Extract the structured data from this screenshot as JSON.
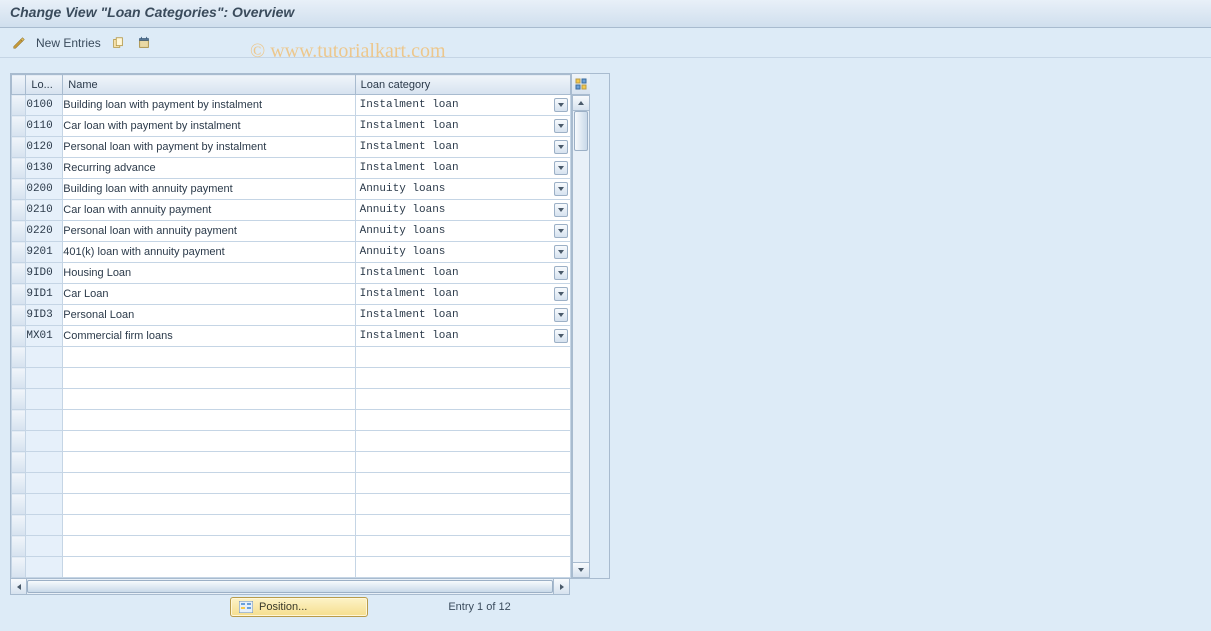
{
  "title": "Change View \"Loan Categories\": Overview",
  "toolbar": {
    "new_entries_label": "New Entries"
  },
  "watermark": "© www.tutorialkart.com",
  "columns": {
    "code": "Lo...",
    "name": "Name",
    "category": "Loan category"
  },
  "rows": [
    {
      "code": "0100",
      "name": "Building loan with payment by instalment",
      "category": "Instalment loan"
    },
    {
      "code": "0110",
      "name": "Car loan with payment by instalment",
      "category": "Instalment loan"
    },
    {
      "code": "0120",
      "name": "Personal loan with payment by instalment",
      "category": "Instalment loan"
    },
    {
      "code": "0130",
      "name": "Recurring advance",
      "category": "Instalment loan"
    },
    {
      "code": "0200",
      "name": "Building loan with annuity payment",
      "category": "Annuity loans"
    },
    {
      "code": "0210",
      "name": "Car loan with annuity payment",
      "category": "Annuity loans"
    },
    {
      "code": "0220",
      "name": "Personal loan with annuity payment",
      "category": "Annuity loans"
    },
    {
      "code": "9201",
      "name": "401(k) loan with annuity payment",
      "category": "Annuity loans"
    },
    {
      "code": "9ID0",
      "name": "Housing Loan",
      "category": "Instalment loan"
    },
    {
      "code": "9ID1",
      "name": "Car Loan",
      "category": "Instalment loan"
    },
    {
      "code": "9ID3",
      "name": "Personal Loan",
      "category": "Instalment loan"
    },
    {
      "code": "MX01",
      "name": "Commercial firm loans",
      "category": "Instalment loan"
    }
  ],
  "empty_rows": 11,
  "footer": {
    "position_label": "Position...",
    "entry_text": "Entry 1 of 12"
  }
}
